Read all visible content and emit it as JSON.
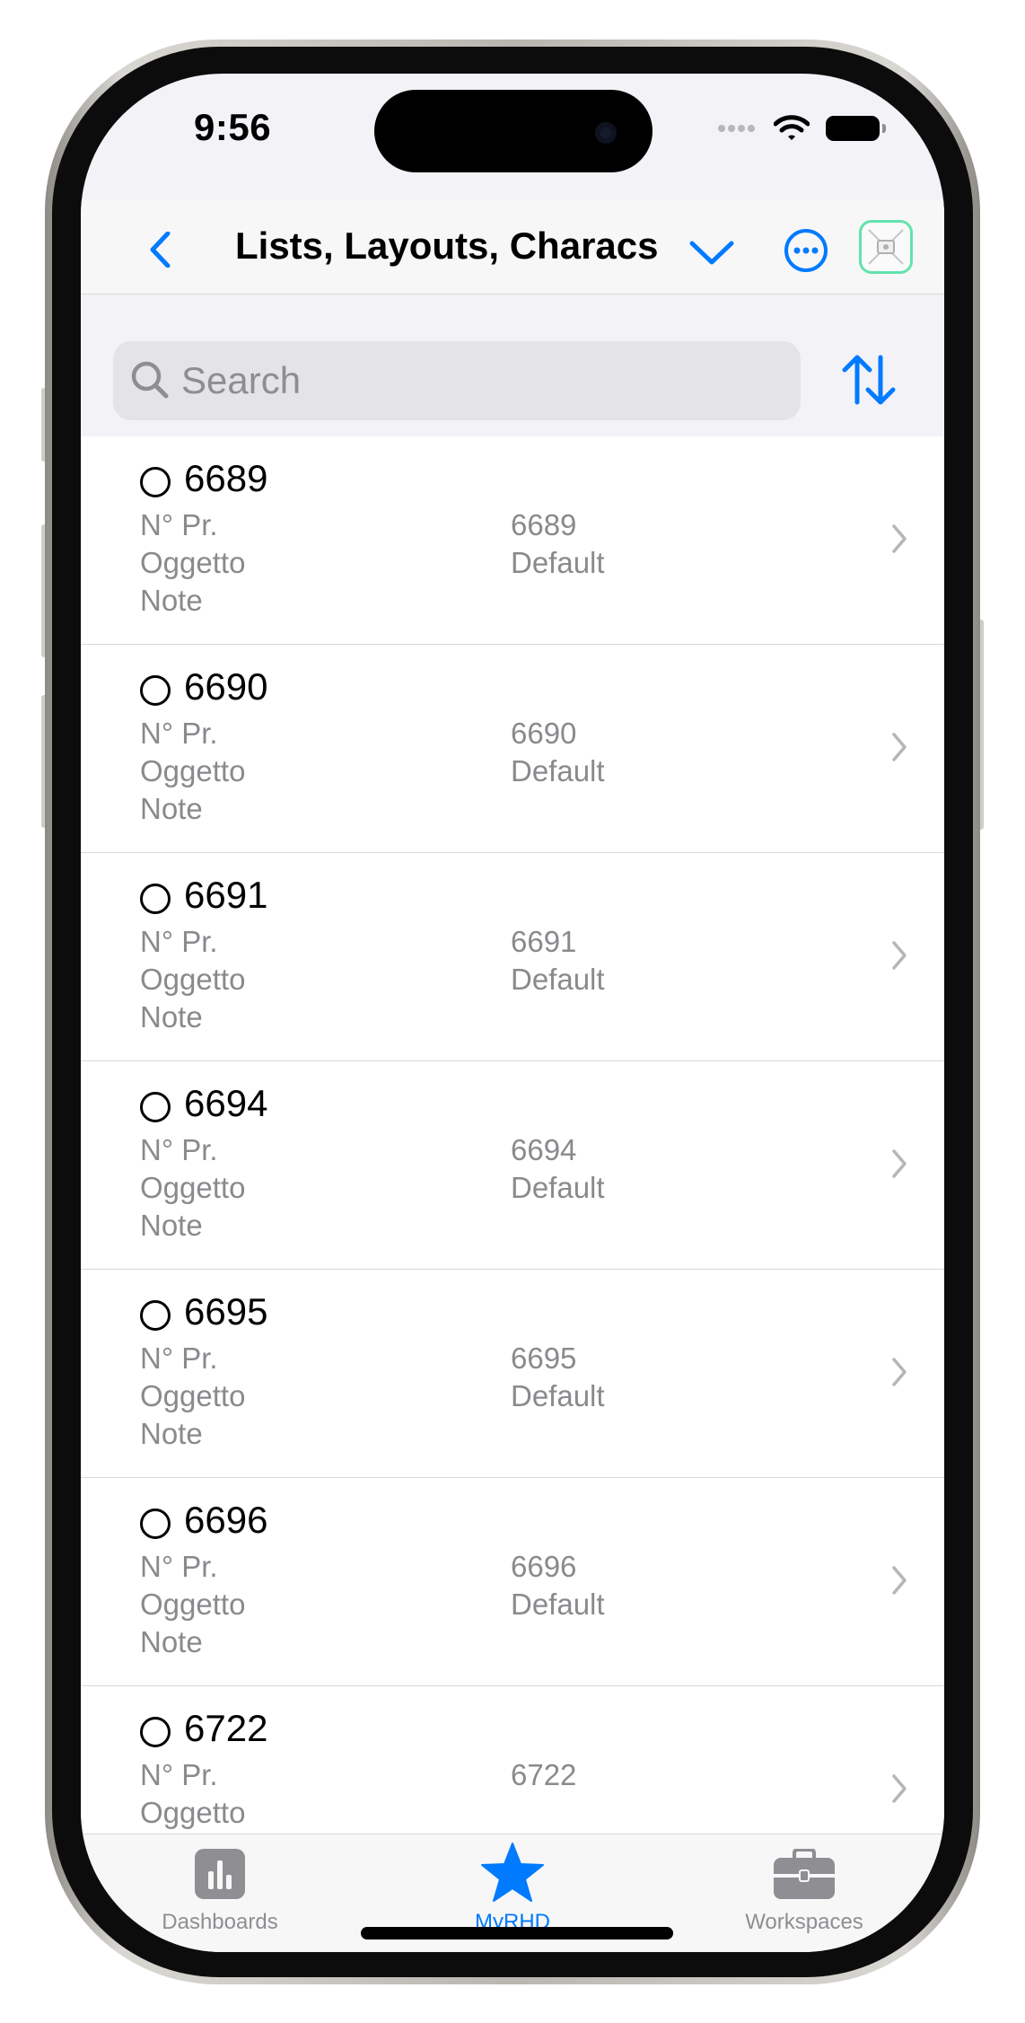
{
  "status_bar": {
    "time": "9:56"
  },
  "navbar": {
    "title": "Lists, Layouts, Characs"
  },
  "search": {
    "placeholder": "Search",
    "value": ""
  },
  "list": {
    "field_labels": {
      "number": "N° Pr.",
      "object": "Oggetto",
      "notes": "Note"
    },
    "rows": [
      {
        "title": "6689",
        "number": "6689",
        "object": "Default",
        "notes": ""
      },
      {
        "title": "6690",
        "number": "6690",
        "object": "Default",
        "notes": ""
      },
      {
        "title": "6691",
        "number": "6691",
        "object": "Default",
        "notes": ""
      },
      {
        "title": "6694",
        "number": "6694",
        "object": "Default",
        "notes": ""
      },
      {
        "title": "6695",
        "number": "6695",
        "object": "Default",
        "notes": ""
      },
      {
        "title": "6696",
        "number": "6696",
        "object": "Default",
        "notes": ""
      },
      {
        "title": "6722",
        "number": "6722",
        "object": "",
        "notes": ""
      }
    ]
  },
  "tabbar": {
    "tabs": [
      {
        "label": "Dashboards",
        "icon": "chart-bar-icon",
        "active": false
      },
      {
        "label": "MyRHD",
        "icon": "star-icon",
        "active": true
      },
      {
        "label": "Workspaces",
        "icon": "briefcase-icon",
        "active": false
      }
    ]
  },
  "colors": {
    "accent": "#007aff",
    "secondary_text": "#8a8a8e",
    "inactive_tab": "#8e8e93",
    "avatar_border": "#62e3ad"
  }
}
